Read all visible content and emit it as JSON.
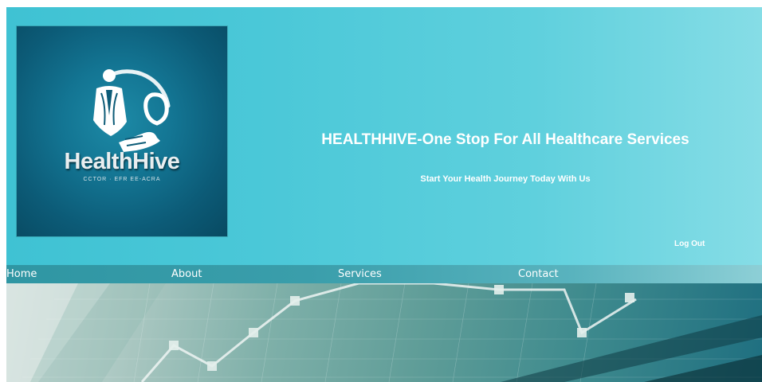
{
  "header": {
    "logo": {
      "name": "HealthHive",
      "tagline": "CCTOR · EFR EE-ACRA"
    },
    "title": "HEALTHHIVE-One Stop For All Healthcare Services",
    "tagline": "Start Your Health Journey Today With Us",
    "logout_label": "Log Out"
  },
  "nav": {
    "items": [
      {
        "label": "Home"
      },
      {
        "label": "About"
      },
      {
        "label": "Services"
      },
      {
        "label": "Contact"
      }
    ]
  },
  "colors": {
    "header_start": "#3fc2d3",
    "header_end": "#86dde6",
    "navbar": "#3a9eab",
    "logo_bg": "#0c5b77",
    "text": "#ffffff"
  }
}
